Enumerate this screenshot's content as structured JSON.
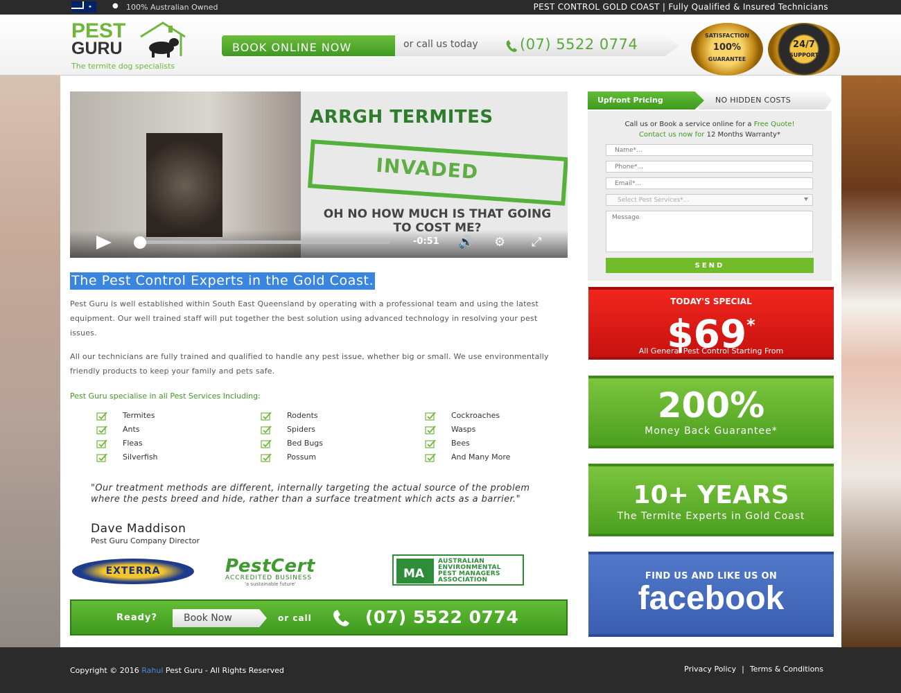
{
  "topbar": {
    "owned": "100% Australian Owned",
    "right_text": "PEST CONTROL GOLD COAST",
    "separator": "|",
    "right_text2": "Fully Qualified & Insured Technicians"
  },
  "header": {
    "logo_word1": "PEST",
    "logo_word2": "GURU",
    "logo_tagline": "The termite dog specialists",
    "book_button": "BOOK ONLINE NOW",
    "call_text": "or call us today",
    "phone": "(07) 5522 0774",
    "badge_satisfaction_top": "SATISFACTION",
    "badge_satisfaction_big": "100%",
    "badge_satisfaction_bottom": "GUARANTEE",
    "badge_support_big": "24/7",
    "badge_support_small": "SUPPORT"
  },
  "video": {
    "title": "ARRGH TERMITES",
    "stamp": "INVADED",
    "question": "OH NO HOW MUCH IS THAT GOING TO COST ME?",
    "time": "-0:51"
  },
  "main": {
    "headline": "The Pest Control Experts in the Gold Coast.",
    "para1": "Pest Guru is well established within South East Queensland by operating with a professional team and using the latest equipment. Our well trained staff will put together the best solution using advanced technology in resolving your pest issues.",
    "para2": "All our technicians are fully trained and qualified to handle any pest issue, whether big or small. We use environmentally friendly products to keep your family and pets safe.",
    "specialise_title": "Pest Guru specialise in all Pest Services Including:",
    "services": [
      "Termites",
      "Rodents",
      "Cockroaches",
      "Ants",
      "Spiders",
      "Wasps",
      "Fleas",
      "Bed Bugs",
      "Bees",
      "Silverfish",
      "Possum",
      "And Many More"
    ],
    "quote": "\"Our treatment methods are different, internally targeting the actual source of the problem where the pests breed and hide, rather than a surface treatment which acts as a barrier.\"",
    "author": "Dave Maddison",
    "author_title": "Pest Guru Company Director"
  },
  "partners": {
    "exterra": "EXTERRA",
    "pestcert": "PestCert",
    "pestcert_sub": "ACCREDITED BUSINESS",
    "pestcert_tag": "'a sustainable future'",
    "aepma_mark": "MA",
    "aepma_line1": "AUSTRALIAN",
    "aepma_line2": "ENVIRONMENTAL",
    "aepma_line3": "PEST MANAGERS",
    "aepma_line4": "ASSOCIATION"
  },
  "cta": {
    "ready": "Ready?",
    "book_now": "Book Now",
    "or_call": "or call",
    "phone": "(07) 5522 0774"
  },
  "sidebar": {
    "tab_upfront": "Upfront Pricing",
    "tab_nohidden": "NO HIDDEN COSTS",
    "intro_line1_a": "Call us or Book a service online for a ",
    "intro_line1_b": "Free Quote!",
    "intro_line2_a": "Contact us now for ",
    "intro_line2_b": "12 Months Warranty*",
    "name_placeholder": "Name*...",
    "phone_placeholder": "Phone*...",
    "email_placeholder": "Email*...",
    "select_placeholder": "Select Pest Services*...",
    "message_placeholder": "Message",
    "send": "SEND"
  },
  "promos": {
    "special_title": "TODAY'S SPECIAL",
    "special_price": "$69",
    "special_star": "*",
    "special_sub": "All General Pest Control Starting From",
    "guarantee_big": "200%",
    "guarantee_sub": "Money Back Guarantee*",
    "years_big": "10+ YEARS",
    "years_sub": "The Termite Experts in Gold Coast",
    "fb_title": "FIND US AND LIKE US ON",
    "fb_logo": "facebook"
  },
  "footer": {
    "copyright_a": "Copyright © 2016 ",
    "copyright_link": "Rahul",
    "copyright_b": " Pest Guru - All Rights Reserved",
    "privacy": "Privacy Policy",
    "separator": "|",
    "terms": "Terms & Conditions"
  },
  "colors": {
    "brand_green": "#62bc36",
    "phone_green": "#59a83a",
    "promo_red": "#e0201a",
    "facebook_blue": "#4469bd",
    "dark_bar": "#2b2b2b",
    "highlight_blue": "#3a86de"
  }
}
